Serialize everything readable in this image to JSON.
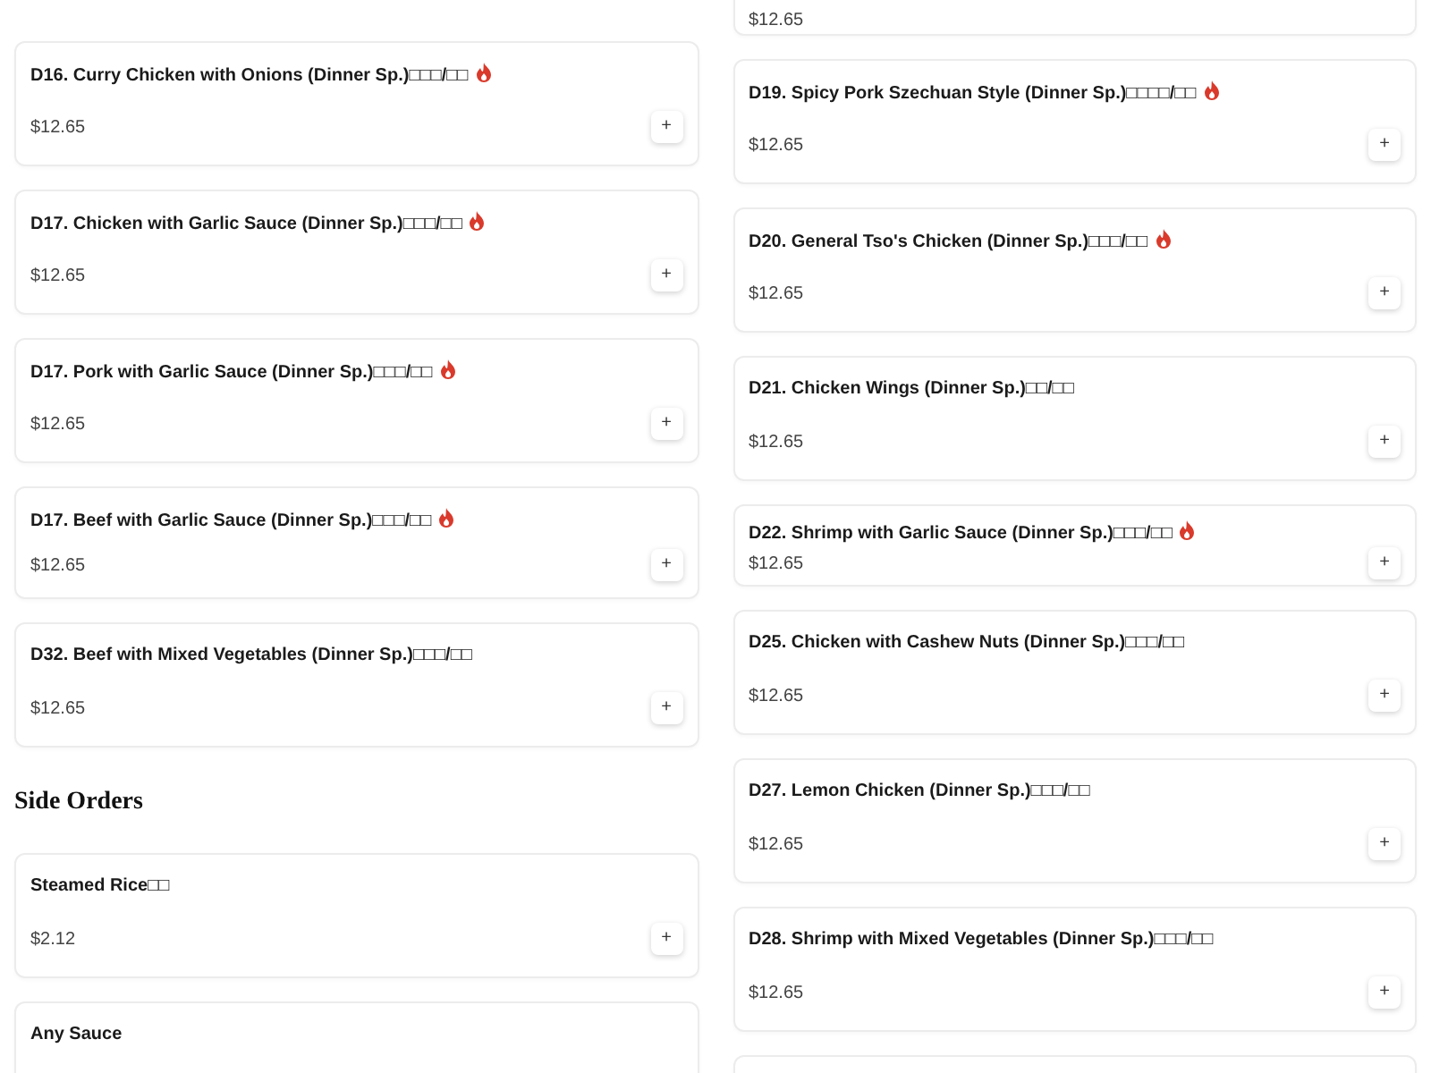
{
  "columns": [
    {
      "items": [
        {
          "kind": "regular",
          "name": "D16. Curry Chicken with Onions (Dinner Sp.)□□□/□□",
          "spicy": true,
          "price": "$12.65",
          "add": "+"
        },
        {
          "kind": "regular",
          "name": "D17. Chicken with Garlic Sauce (Dinner Sp.)□□□/□□",
          "spicy": true,
          "price": "$12.65",
          "add": "+"
        },
        {
          "kind": "regular",
          "name": "D17. Pork with Garlic Sauce (Dinner Sp.)□□□/□□",
          "spicy": true,
          "price": "$12.65",
          "add": "+"
        },
        {
          "kind": "short",
          "name": "D17. Beef with Garlic Sauce (Dinner Sp.)□□□/□□",
          "spicy": true,
          "price": "$12.65",
          "add": "+"
        },
        {
          "kind": "regular",
          "name": "D32. Beef with Mixed Vegetables (Dinner Sp.)□□□/□□",
          "spicy": false,
          "price": "$12.65",
          "add": "+"
        },
        {
          "kind": "heading",
          "name": "Side Orders"
        },
        {
          "kind": "regular",
          "name": "Steamed Rice□□",
          "spicy": false,
          "price": "$2.12",
          "add": "+"
        },
        {
          "kind": "regular",
          "name": "Any Sauce",
          "spicy": false
        }
      ]
    },
    {
      "items": [
        {
          "kind": "partial",
          "price": "$12.65"
        },
        {
          "kind": "regular",
          "name": "D19. Spicy Pork Szechuan Style (Dinner Sp.)□□□□/□□",
          "spicy": true,
          "price": "$12.65",
          "add": "+"
        },
        {
          "kind": "regular",
          "name": "D20. General Tso's Chicken (Dinner Sp.)□□□/□□",
          "spicy": true,
          "price": "$12.65",
          "add": "+"
        },
        {
          "kind": "regular",
          "name": "D21. Chicken Wings (Dinner Sp.)□□/□□",
          "spicy": false,
          "price": "$12.65",
          "add": "+"
        },
        {
          "kind": "compact",
          "name": "D22. Shrimp with Garlic Sauce (Dinner Sp.)□□□/□□",
          "spicy": true,
          "price": "$12.65",
          "add": "+"
        },
        {
          "kind": "regular",
          "name": "D25. Chicken with Cashew Nuts (Dinner Sp.)□□□/□□",
          "spicy": false,
          "price": "$12.65",
          "add": "+"
        },
        {
          "kind": "regular",
          "name": "D27. Lemon Chicken (Dinner Sp.)□□□/□□",
          "spicy": false,
          "price": "$12.65",
          "add": "+"
        },
        {
          "kind": "regular",
          "name": "D28. Shrimp with Mixed Vegetables (Dinner Sp.)□□□/□□",
          "spicy": false,
          "price": "$12.65",
          "add": "+"
        },
        {
          "kind": "empty"
        }
      ]
    }
  ]
}
